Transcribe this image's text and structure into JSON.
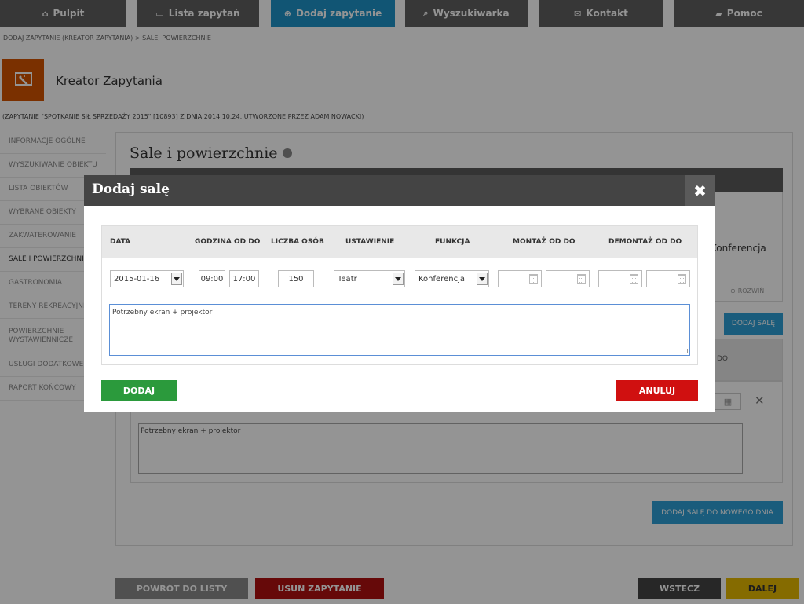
{
  "colors": {
    "nav_bg": "#5f5f5f",
    "nav_active": "#1e93c8",
    "accent_orange": "#d35400",
    "add_green": "#2b9a3c",
    "cancel_red": "#d01010",
    "info_blue": "#2e9fd6",
    "next_yellow": "#e6b800"
  },
  "nav": {
    "tabs": [
      {
        "icon": "home-icon",
        "label": "Pulpit"
      },
      {
        "icon": "inbox-icon",
        "label": "Lista zapytań"
      },
      {
        "icon": "plus-circle-icon",
        "label": "Dodaj zapytanie"
      },
      {
        "icon": "search-icon",
        "label": "Wyszukiwarka"
      },
      {
        "icon": "envelope-icon",
        "label": "Kontakt"
      },
      {
        "icon": "book-icon",
        "label": "Pomoc"
      }
    ]
  },
  "breadcrumb": "DODAJ ZAPYTANIE (KREATOR ZAPYTANIA) > SALE, POWIERZCHNIE",
  "wizard": {
    "icon": "wizard-icon",
    "title": "Kreator Zapytania",
    "request_info": "(ZAPYTANIE \"SPOTKANIE SIŁ SPRZEDAŻY 2015\" [10893] Z DNIA 2014.10.24, UTWORZONE PRZEZ ADAM NOWACKI)"
  },
  "sidebar": {
    "items": [
      {
        "label": "INFORMACJE OGÓLNE"
      },
      {
        "label": "WYSZUKIWANIE OBIEKTU"
      },
      {
        "label": "LISTA OBIEKTÓW"
      },
      {
        "label": "WYBRANE OBIEKTY"
      },
      {
        "label": "ZAKWATEROWANIE"
      },
      {
        "label": "SALE I POWIERZCHNIE"
      },
      {
        "label": "GASTRONOMIA"
      },
      {
        "label": "TERENY REKREACYJNE"
      },
      {
        "label": "POWIERZCHNIE WYSTAWIENNICZE"
      },
      {
        "label": "USŁUGI DODATKOWE"
      },
      {
        "label": "RAPORT KOŃCOWY"
      }
    ]
  },
  "main": {
    "section_title": "Sale i powierzchnie",
    "function_value": "Konferencja",
    "expand_label": "ROZWIŃ",
    "add_room_label": "DODAJ SALĘ",
    "demontaz_partial": "DO",
    "notes_value": "Potrzebny ekran + projektor",
    "add_room_new_day_label": "DODAJ SALĘ DO NOWEGO DNIA"
  },
  "footer": {
    "back_to_list": "POWRÓT DO LISTY",
    "delete_request": "USUŃ ZAPYTANIE",
    "back": "WSTECZ",
    "next": "DALEJ"
  },
  "modal": {
    "title": "Dodaj salę",
    "columns": {
      "date": "DATA",
      "time": "GODZINA OD DO",
      "people": "LICZBA OSÓB",
      "setup": "USTAWIENIE",
      "function": "FUNKCJA",
      "montaz": "MONTAŻ OD DO",
      "demontaz": "DEMONTAŻ OD DO"
    },
    "fields": {
      "date": "2015-01-16",
      "time_from": "09:00",
      "time_to": "17:00",
      "people": "150",
      "setup": "Teatr",
      "function": "Konferencja",
      "montaz_from": "",
      "montaz_to": "",
      "demontaz_from": "",
      "demontaz_to": ""
    },
    "notes": "Potrzebny ekran + projektor",
    "add_button": "DODAJ",
    "cancel_button": "ANULUJ"
  }
}
